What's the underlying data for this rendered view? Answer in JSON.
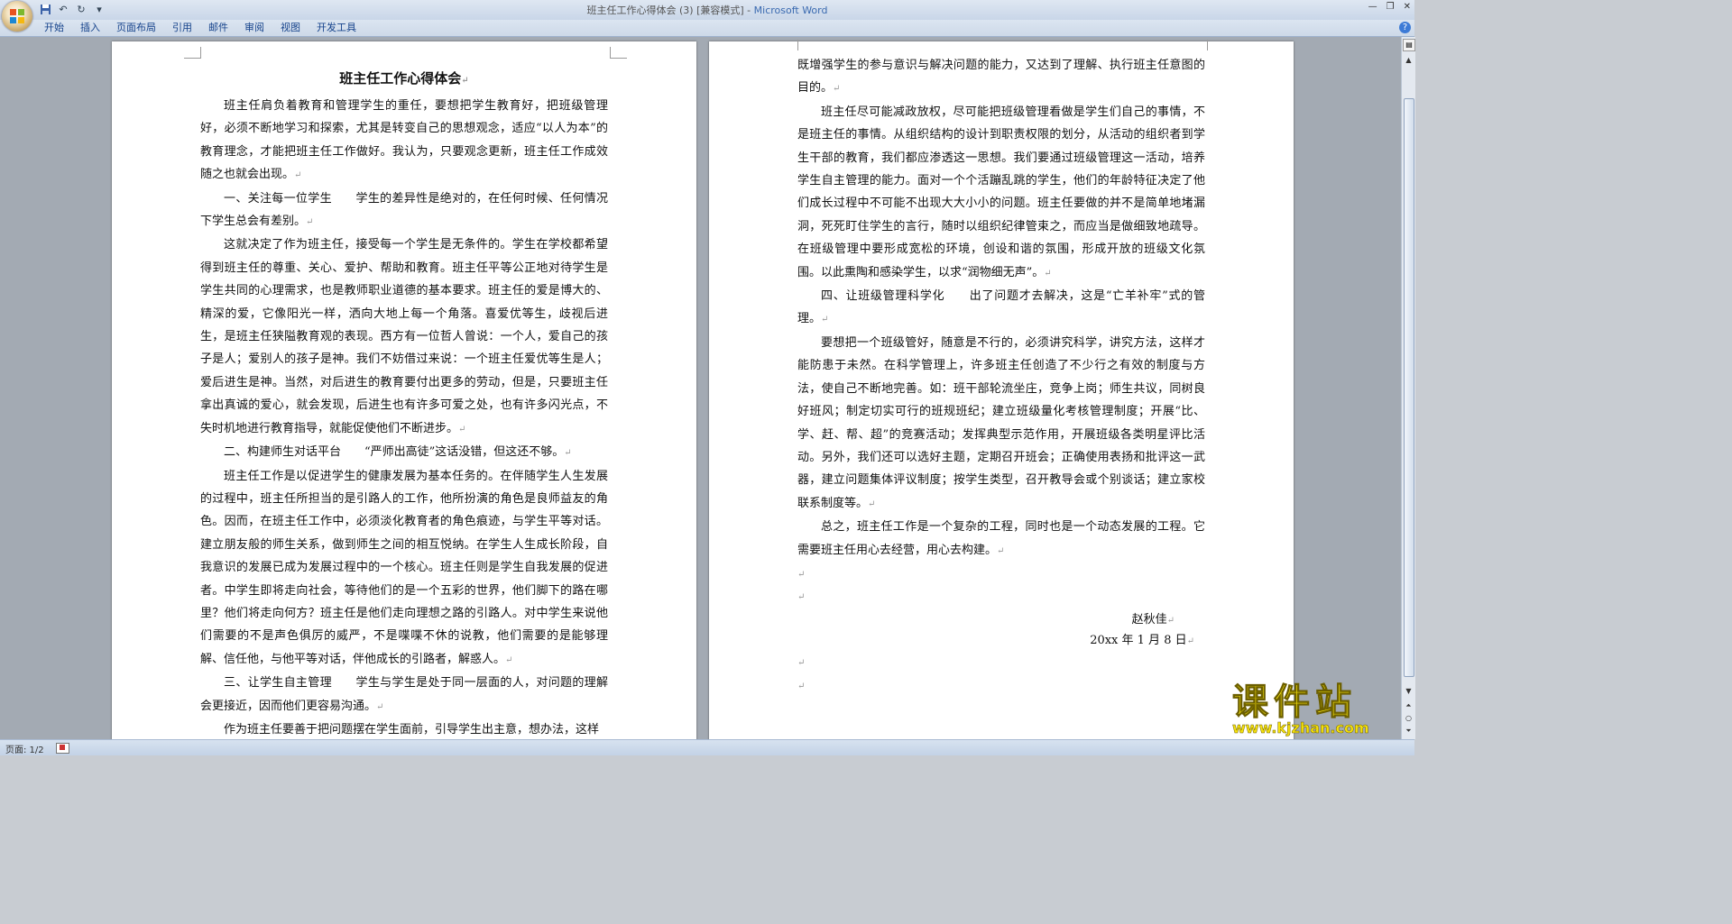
{
  "window": {
    "title": "班主任工作心得体会 (3) [兼容模式] - ",
    "app_name": "Microsoft Word"
  },
  "quick_access": [
    "save-icon",
    "undo-icon",
    "redo-icon",
    "customize-icon"
  ],
  "ribbon": {
    "tabs": [
      "开始",
      "插入",
      "页面布局",
      "引用",
      "邮件",
      "审阅",
      "视图",
      "开发工具"
    ]
  },
  "document": {
    "page1": {
      "title": "班主任工作心得体会",
      "paragraphs": [
        "班主任肩负着教育和管理学生的重任，要想把学生教育好，把班级管理好，必须不断地学习和探索，尤其是转变自己的思想观念，适应“以人为本”的教育理念，才能把班主任工作做好。我认为，只要观念更新，班主任工作成效随之也就会出现。",
        "一、关注每一位学生　　学生的差异性是绝对的，在任何时候、任何情况下学生总会有差别。",
        " 这就决定了作为班主任，接受每一个学生是无条件的。学生在学校都希望得到班主任的尊重、关心、爱护、帮助和教育。班主任平等公正地对待学生是学生共同的心理需求，也是教师职业道德的基本要求。班主任的爱是博大的、精深的爱，它像阳光一样，洒向大地上每一个角落。喜爱优等生，歧视后进生，是班主任狭隘教育观的表现。西方有一位哲人曾说：一个人，爱自己的孩子是人；爱别人的孩子是神。我们不妨借过来说：一个班主任爱优等生是人；爱后进生是神。当然，对后进生的教育要付出更多的劳动，但是，只要班主任拿出真诚的爱心，就会发现，后进生也有许多可爱之处，也有许多闪光点，不失时机地进行教育指导，就能促使他们不断进步。",
        " 二、构建师生对话平台　　“严师出高徒”这话没错，但这还不够。",
        " 班主任工作是以促进学生的健康发展为基本任务的。在伴随学生人生发展的过程中，班主任所担当的是引路人的工作，他所扮演的角色是良师益友的角色。因而，在班主任工作中，必须淡化教育者的角色痕迹，与学生平等对话。建立朋友般的师生关系，做到师生之间的相互悦纳。在学生人生成长阶段，自我意识的发展已成为发展过程中的一个核心。班主任则是学生自我发展的促进者。中学生即将走向社会，等待他们的是一个五彩的世界，他们脚下的路在哪里？他们将走向何方？班主任是他们走向理想之路的引路人。对中学生来说他们需要的不是声色俱厉的威严，不是喋喋不休的说教，他们需要的是能够理解、信任他，与他平等对话，伴他成长的引路者，解惑人。",
        " 三、让学生自主管理　　学生与学生是处于同一层面的人，对问题的理解会更接近，因而他们更容易沟通。",
        " 作为班主任要善于把问题摆在学生面前，引导学生出主意，想办法，这样"
      ]
    },
    "page2": {
      "paragraphs": [
        "既增强学生的参与意识与解决问题的能力，又达到了理解、执行班主任意图的目的。",
        "班主任尽可能减政放权，尽可能把班级管理看做是学生们自己的事情，不是班主任的事情。从组织结构的设计到职责权限的划分，从活动的组织者到学生干部的教育，我们都应渗透这一思想。我们要通过班级管理这一活动，培养学生自主管理的能力。面对一个个活蹦乱跳的学生，他们的年龄特征决定了他们成长过程中不可能不出现大大小小的问题。班主任要做的并不是简单地堵漏洞，死死盯住学生的言行，随时以组织纪律管束之，而应当是做细致地疏导。在班级管理中要形成宽松的环境，创设和谐的氛围，形成开放的班级文化氛围。以此熏陶和感染学生，以求“润物细无声”。",
        "四、让班级管理科学化　　出了问题才去解决，这是“亡羊补牢”式的管理。",
        "要想把一个班级管好，随意是不行的，必须讲究科学，讲究方法，这样才能防患于未然。在科学管理上，许多班主任创造了不少行之有效的制度与方法，使自己不断地完善。如：班干部轮流坐庄，竞争上岗；师生共议，同树良好班风；制定切实可行的班规班纪；建立班级量化考核管理制度；开展“比、学、赶、帮、超”的竞赛活动；发挥典型示范作用，开展班级各类明星评比活动。另外，我们还可以选好主题，定期召开班会；正确使用表扬和批评这一武器，建立问题集体评议制度；按学生类型，召开教导会或个别谈话；建立家校联系制度等。",
        "总之，班主任工作是一个复杂的工程，同时也是一个动态发展的工程。它需要班主任用心去经营，用心去构建。"
      ],
      "signature": "赵秋佳",
      "date": "20xx 年 1 月 8 日"
    }
  },
  "status_bar": {
    "page_indicator": "页面: 1/2"
  },
  "watermark": {
    "text": "课件站",
    "url": "www.kjzhan.com"
  },
  "colors": {
    "workspace": "#a3aab3",
    "ribbon_text": "#15428b",
    "app_name": "#3a6ab0",
    "watermark": "#f6e20d"
  }
}
